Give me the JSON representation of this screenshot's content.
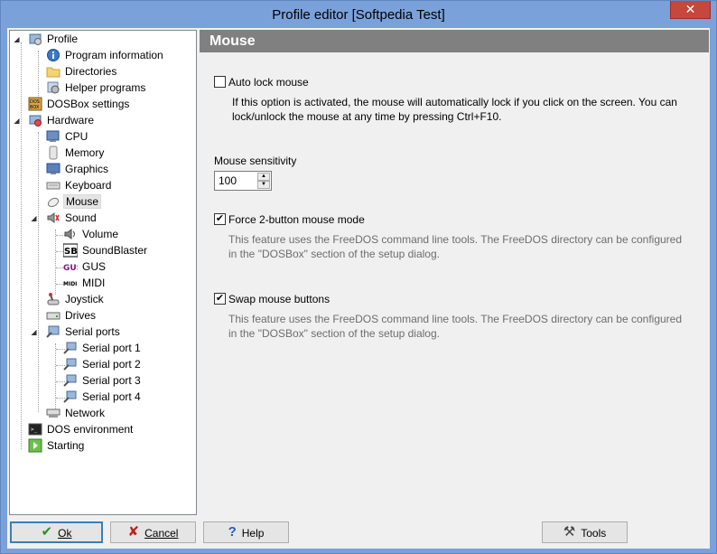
{
  "window": {
    "title": "Profile editor [Softpedia Test]",
    "close_glyph": "✕"
  },
  "tree": {
    "items": [
      {
        "label": "Profile",
        "icon": "profile-icon"
      },
      {
        "label": "Program information",
        "icon": "info-icon"
      },
      {
        "label": "Directories",
        "icon": "folder-icon"
      },
      {
        "label": "Helper programs",
        "icon": "gear-icon"
      },
      {
        "label": "DOSBox settings",
        "icon": "dosbox-icon"
      },
      {
        "label": "Hardware",
        "icon": "hardware-icon"
      },
      {
        "label": "CPU",
        "icon": "cpu-icon"
      },
      {
        "label": "Memory",
        "icon": "memory-icon"
      },
      {
        "label": "Graphics",
        "icon": "monitor-icon"
      },
      {
        "label": "Keyboard",
        "icon": "keyboard-icon"
      },
      {
        "label": "Mouse",
        "icon": "mouse-icon"
      },
      {
        "label": "Sound",
        "icon": "speaker-icon"
      },
      {
        "label": "Volume",
        "icon": "volume-icon"
      },
      {
        "label": "SoundBlaster",
        "icon": "soundblaster-icon"
      },
      {
        "label": "GUS",
        "icon": "gus-icon"
      },
      {
        "label": "MIDI",
        "icon": "midi-icon"
      },
      {
        "label": "Joystick",
        "icon": "joystick-icon"
      },
      {
        "label": "Drives",
        "icon": "drive-icon"
      },
      {
        "label": "Serial ports",
        "icon": "serial-icon"
      },
      {
        "label": "Serial port 1",
        "icon": "serial-port-icon"
      },
      {
        "label": "Serial port 2",
        "icon": "serial-port-icon"
      },
      {
        "label": "Serial port 3",
        "icon": "serial-port-icon"
      },
      {
        "label": "Serial port 4",
        "icon": "serial-port-icon"
      },
      {
        "label": "Network",
        "icon": "network-icon"
      },
      {
        "label": "DOS environment",
        "icon": "terminal-icon"
      },
      {
        "label": "Starting",
        "icon": "start-icon"
      }
    ],
    "selected": "Mouse"
  },
  "panel": {
    "title": "Mouse",
    "auto_lock": {
      "label": "Auto lock mouse",
      "checked": false,
      "desc_line1": "If this option is activated, the mouse will automatically lock if you click on the screen. You can",
      "desc_line2": "lock/unlock the mouse at any time by pressing Ctrl+F10."
    },
    "sensitivity": {
      "label": "Mouse sensitivity",
      "value": "100"
    },
    "force_2button": {
      "label": "Force 2-button mouse mode",
      "checked": true,
      "desc_line1": "This feature uses the FreeDOS command line tools. The FreeDOS directory can be configured",
      "desc_line2": "in the \"DOSBox\" section of the setup dialog."
    },
    "swap_buttons": {
      "label": "Swap mouse buttons",
      "checked": true,
      "desc_line1": "This feature uses the FreeDOS command line tools. The FreeDOS directory can be configured",
      "desc_line2": "in the \"DOSBox\" section of the setup dialog."
    },
    "check_glyph": "✔"
  },
  "buttons": {
    "ok": {
      "label": "Ok",
      "glyph": "✔"
    },
    "cancel": {
      "label": "Cancel",
      "glyph": "✘"
    },
    "help": {
      "label": "Help",
      "glyph": "?"
    },
    "tools": {
      "label": "Tools",
      "glyph": "⚒"
    }
  },
  "colors": {
    "window_frame": "#7aa1d9",
    "close_button": "#c7463e",
    "panel_header": "#808080",
    "ok_check": "#2e8b2e",
    "cancel_x": "#c02020",
    "help_q": "#1f5fbf"
  }
}
